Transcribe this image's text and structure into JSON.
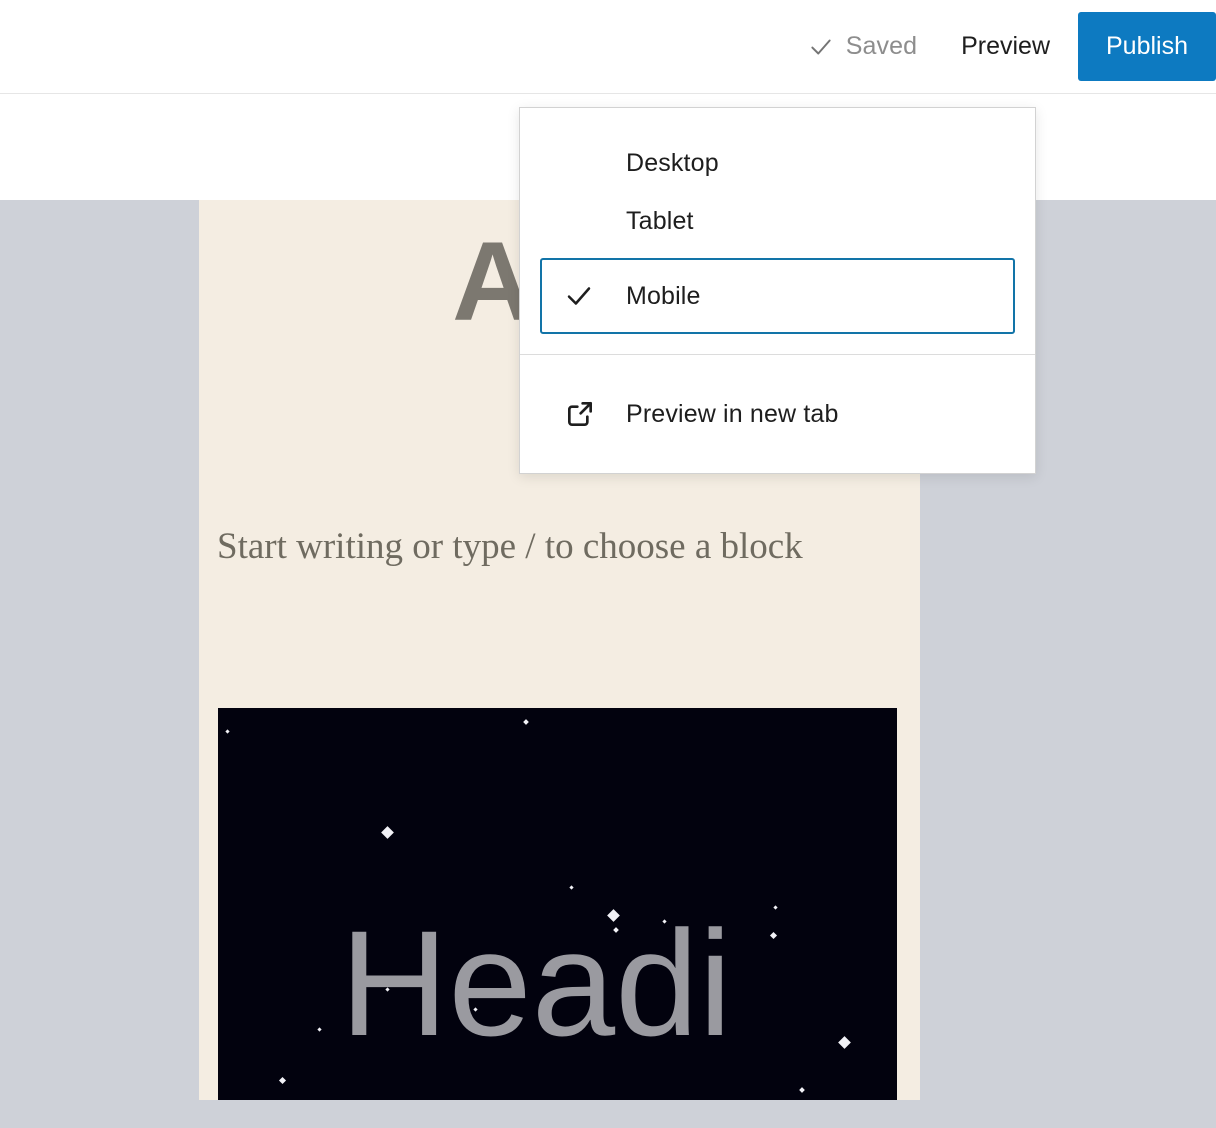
{
  "topbar": {
    "saved_label": "Saved",
    "saved_icon": "check-icon",
    "preview_label": "Preview",
    "publish_label": "Publish",
    "publish_color": "#0d7ac1"
  },
  "preview_menu": {
    "items": [
      {
        "label": "Desktop",
        "selected": false,
        "icon": ""
      },
      {
        "label": "Tablet",
        "selected": false,
        "icon": ""
      },
      {
        "label": "Mobile",
        "selected": true,
        "icon": "check-icon"
      }
    ],
    "footer": {
      "label": "Preview in new tab",
      "icon": "external-link-icon"
    },
    "selected_outline_color": "#1274a8"
  },
  "editor": {
    "canvas_background": "#f4ede2",
    "workspace_background": "#ced1d8",
    "post_title_placeholder": "Add",
    "paragraph_placeholder": "Start writing or type / to choose a block",
    "cover_block": {
      "background": "#02020e",
      "heading_text": "Headi",
      "heading_color": "#9a9aa0"
    }
  }
}
